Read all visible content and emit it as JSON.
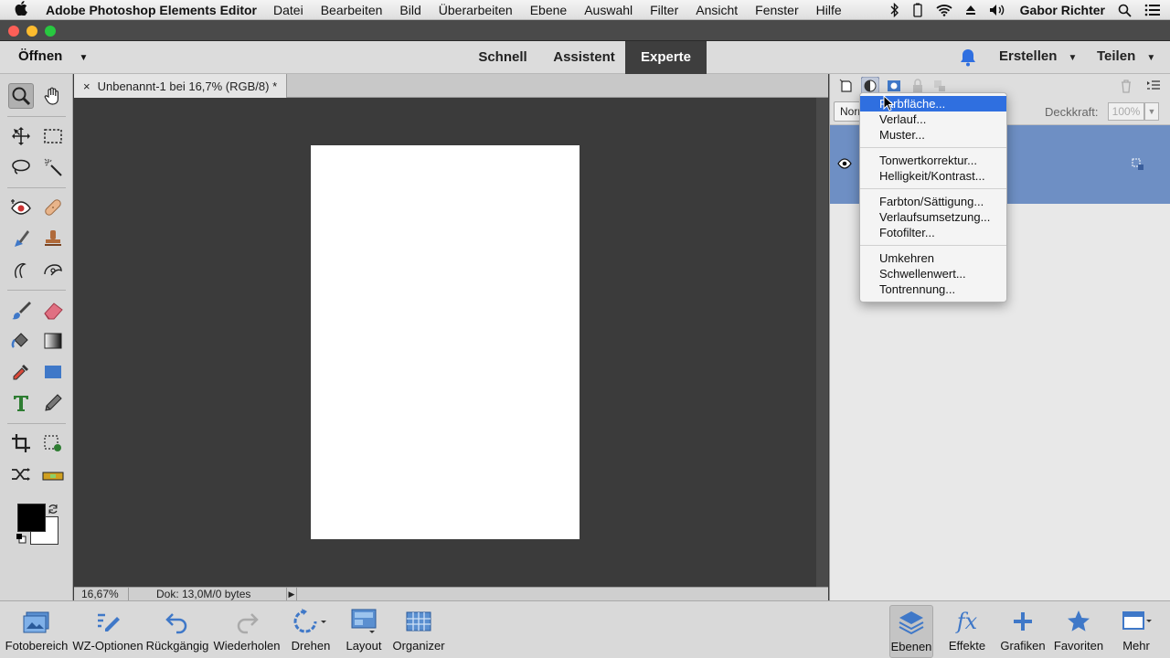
{
  "menubar": {
    "app_name": "Adobe Photoshop Elements Editor",
    "items": [
      "Datei",
      "Bearbeiten",
      "Bild",
      "Überarbeiten",
      "Ebene",
      "Auswahl",
      "Filter",
      "Ansicht",
      "Fenster",
      "Hilfe"
    ],
    "user": "Gabor Richter"
  },
  "topbar": {
    "open_label": "Öffnen",
    "modes": [
      "Schnell",
      "Assistent",
      "Experte"
    ],
    "active_mode": "Experte",
    "create_label": "Erstellen",
    "share_label": "Teilen"
  },
  "document": {
    "tab_title": "Unbenannt-1 bei 16,7% (RGB/8) *",
    "close_glyph": "×",
    "zoom": "16,67%",
    "doc_size": "Dok: 13,0M/0 bytes"
  },
  "layers": {
    "blend_mode": "Normal",
    "opacity_label": "Deckkraft:",
    "opacity_value": "100%"
  },
  "adjustment_menu": {
    "groups": [
      [
        "Farbfläche...",
        "Verlauf...",
        "Muster..."
      ],
      [
        "Tonwertkorrektur...",
        "Helligkeit/Kontrast..."
      ],
      [
        "Farbton/Sättigung...",
        "Verlaufsumsetzung...",
        "Fotofilter..."
      ],
      [
        "Umkehren",
        "Schwellenwert...",
        "Tontrennung..."
      ]
    ],
    "highlighted": "Farbfläche..."
  },
  "bottombar": {
    "left": [
      "Fotobereich",
      "WZ-Optionen",
      "Rückgängig",
      "Wiederholen",
      "Drehen",
      "Layout",
      "Organizer"
    ],
    "right": [
      "Ebenen",
      "Effekte",
      "Grafiken",
      "Favoriten",
      "Mehr"
    ],
    "active": "Ebenen"
  },
  "colors": {
    "accent": "#2f6fe0",
    "layer_selected": "#6e8fc4",
    "canvas_bg": "#3b3b3b"
  }
}
